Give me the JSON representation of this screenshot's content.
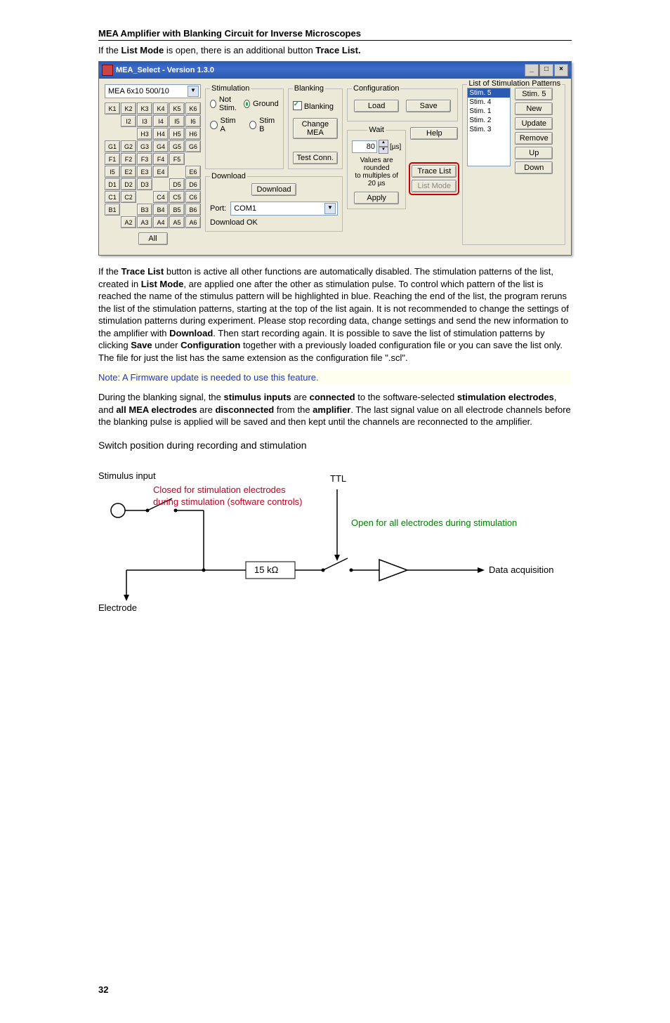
{
  "heading": "MEA Amplifier with Blanking Circuit for Inverse Microscopes",
  "intro_parts": {
    "p1": "If the ",
    "b1": "List Mode",
    "p2": " is open, there is an additional button ",
    "b2": "Trace List.",
    "p3": ""
  },
  "window": {
    "title": "MEA_Select - Version 1.3.0",
    "min": "_",
    "max": "□",
    "close": "×",
    "device": "MEA 6x10 500/10",
    "grid": [
      [
        "K1",
        "K2",
        "K3",
        "K4",
        "K5",
        "K6"
      ],
      [
        "",
        "I2",
        "I3",
        "I4",
        "I5",
        "I6"
      ],
      [
        "",
        "",
        "H3",
        "H4",
        "H5",
        "H6"
      ],
      [
        "G1",
        "G2",
        "G3",
        "G4",
        "G5",
        "G6"
      ],
      [
        "F1",
        "F2",
        "F3",
        "F4",
        "F5",
        ""
      ],
      [
        "I5",
        "E2",
        "E3",
        "E4",
        "",
        "E6"
      ],
      [
        "D1",
        "D2",
        "D3",
        "",
        "D5",
        "D6"
      ],
      [
        "C1",
        "C2",
        "",
        "C4",
        "C5",
        "C6"
      ],
      [
        "B1",
        "",
        "B3",
        "B4",
        "B5",
        "B6"
      ],
      [
        "",
        "A2",
        "A3",
        "A4",
        "A5",
        "A6"
      ]
    ],
    "all_btn": "All",
    "stimulation": {
      "legend": "Stimulation",
      "not_stim": "Not Stim.",
      "ground": "Ground",
      "stim_a": "Stim A",
      "stim_b": "Stim B"
    },
    "blanking": {
      "legend": "Blanking",
      "checkbox": "Blanking",
      "change_mea": "Change MEA",
      "test_conn": "Test Conn."
    },
    "download": {
      "legend": "Download",
      "btn": "Download",
      "port_label": "Port:",
      "port": "COM1",
      "status": "Download OK"
    },
    "configuration": {
      "legend": "Configuration",
      "load": "Load",
      "save": "Save",
      "help": "Help",
      "tracelist": "Trace List",
      "listmode": "List Mode"
    },
    "wait": {
      "legend": "Wait",
      "value": "80",
      "unit": "[µs]",
      "note1": "Values are rounded",
      "note2": "to multiples of 20 µs",
      "apply": "Apply"
    },
    "patterns": {
      "legend": "List of Stimulation Patterns",
      "items": [
        "Stim. 5",
        "Stim. 4",
        "Stim. 1",
        "Stim. 2",
        "Stim. 3"
      ],
      "selected": 0,
      "stim5": "Stim. 5",
      "new": "New",
      "update": "Update",
      "remove": "Remove",
      "up": "Up",
      "down": "Down"
    }
  },
  "para1": {
    "t1": "If the ",
    "b1": "Trace List",
    "t2": " button is active all other functions are automatically disabled. The stimulation patterns of the list, created in ",
    "b2": "List Mode",
    "t3": ", are applied one after the other as stimulation pulse. To control which pattern of the list is reached the name of the stimulus pattern will be highlighted in blue. Reaching the end of the list, the program reruns the list of the stimulation patterns, starting at the top of the list again. It is not recommended to change the settings of stimulation patterns during experiment. Please stop recording data, change settings and send the new information to the amplifier with ",
    "b3": "Download",
    "t4": ". Then start recording again. It is possible to save the list of stimulation patterns by clicking ",
    "b4": "Save",
    "t5": " under ",
    "b5": "Configuration",
    "t6": " together with a previously loaded configuration file or you can save the list only. The file for just the list has the same extension as the configuration file \".scl\"."
  },
  "note": "Note: A Firmware update is needed to use this feature.",
  "para2": {
    "t1": "During the blanking signal, the ",
    "b1": "stimulus inputs",
    "t2": " are ",
    "b2": "connected",
    "t3": " to the software-selected ",
    "b3": "stimulation electrodes",
    "t4": ", and ",
    "b4": "all MEA electrodes",
    "t5": " are ",
    "b5": "disconnected",
    "t6": " from the ",
    "b6": "amplifier",
    "t7": ". The last signal value on all electrode channels before the blanking pulse is applied will be saved and then kept until the channels are reconnected to the amplifier."
  },
  "diagram": {
    "title": "Switch position during recording and stimulation",
    "stim_input": "Stimulus input",
    "red1": "Closed for stimulation electrodes",
    "red2": "during stimulation (software controls)",
    "ttl": "TTL",
    "green": "Open for all electrodes during stimulation",
    "res": "15 kΩ",
    "da": "Data acquisition",
    "electrode": "Electrode"
  },
  "page_number": "32"
}
